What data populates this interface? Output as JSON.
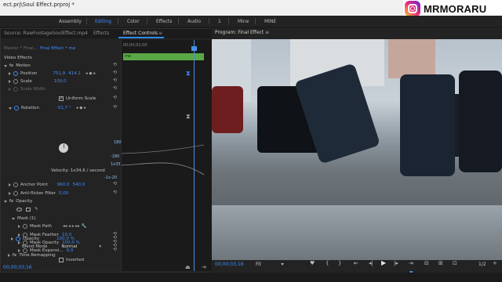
{
  "titlebar": {
    "title": "ect.prj\\Soul Effect.prproj *"
  },
  "watermark": {
    "handle": "MRMORARU"
  },
  "workspaces": [
    "Assembly",
    "Editing",
    "Color",
    "Effects",
    "Audio",
    "1",
    "Mine",
    "MINE"
  ],
  "workspace_active": "Editing",
  "left_tabs": {
    "source": "Source: RawFootageSoulEffect.mp4",
    "effects": "Effects",
    "effect_controls": "Effect Controls",
    "menu": "≡"
  },
  "ec": {
    "master": "Master * Final...",
    "sequence": "Final Effect * me",
    "ruler_time": "00;00;02;00",
    "clip_label": "me",
    "section_video": "Video Effects",
    "motion": "Motion",
    "position": {
      "label": "Position",
      "x": "751,9",
      "y": "414,1"
    },
    "scale": {
      "label": "Scale",
      "value": "100,0"
    },
    "scale_width": {
      "label": "Scale Width"
    },
    "uniform_scale": "Uniform Scale",
    "rotation": {
      "label": "Rotation",
      "value": "-51,7 °"
    },
    "graph_top": "180",
    "graph_mid": "-180",
    "graph_low": "1x35",
    "velocity": "Velocity: 1x34,6 / second",
    "velocity_low": "-1x-20",
    "anchor": {
      "label": "Anchor Point",
      "x": "960,0",
      "y": "540,0"
    },
    "antiflicker": {
      "label": "Anti-flicker Filter",
      "value": "0,00"
    },
    "opacity": "Opacity",
    "mask": "Mask (1)",
    "mask_path": "Mask Path",
    "mask_feather": {
      "label": "Mask Feather",
      "value": "10,0"
    },
    "mask_opacity": {
      "label": "Mask Opacity",
      "value": "100,0 %"
    },
    "mask_expansion": {
      "label": "Mask Expansi...",
      "value": "0,0"
    },
    "inverted": "Inverted",
    "opacity_value": {
      "label": "Opacity",
      "value": "100,0 %"
    },
    "blend": {
      "label": "Blend Mode",
      "value": "Normal"
    },
    "time_remap": "Time Remapping",
    "timecode": "00;00;03;16"
  },
  "monitor": {
    "tab": "Program: Final Effect",
    "menu": "≡",
    "timecode": "00;00;03;16",
    "fit": "Fit",
    "zoom": "1/2"
  },
  "colors": {
    "accent": "#3e8dff",
    "clip": "#5aa845"
  },
  "icons": [
    "instagram-icon",
    "stopwatch-icon",
    "reset-icon",
    "keyframe-icon",
    "play-icon",
    "mouse-cursor-icon"
  ]
}
